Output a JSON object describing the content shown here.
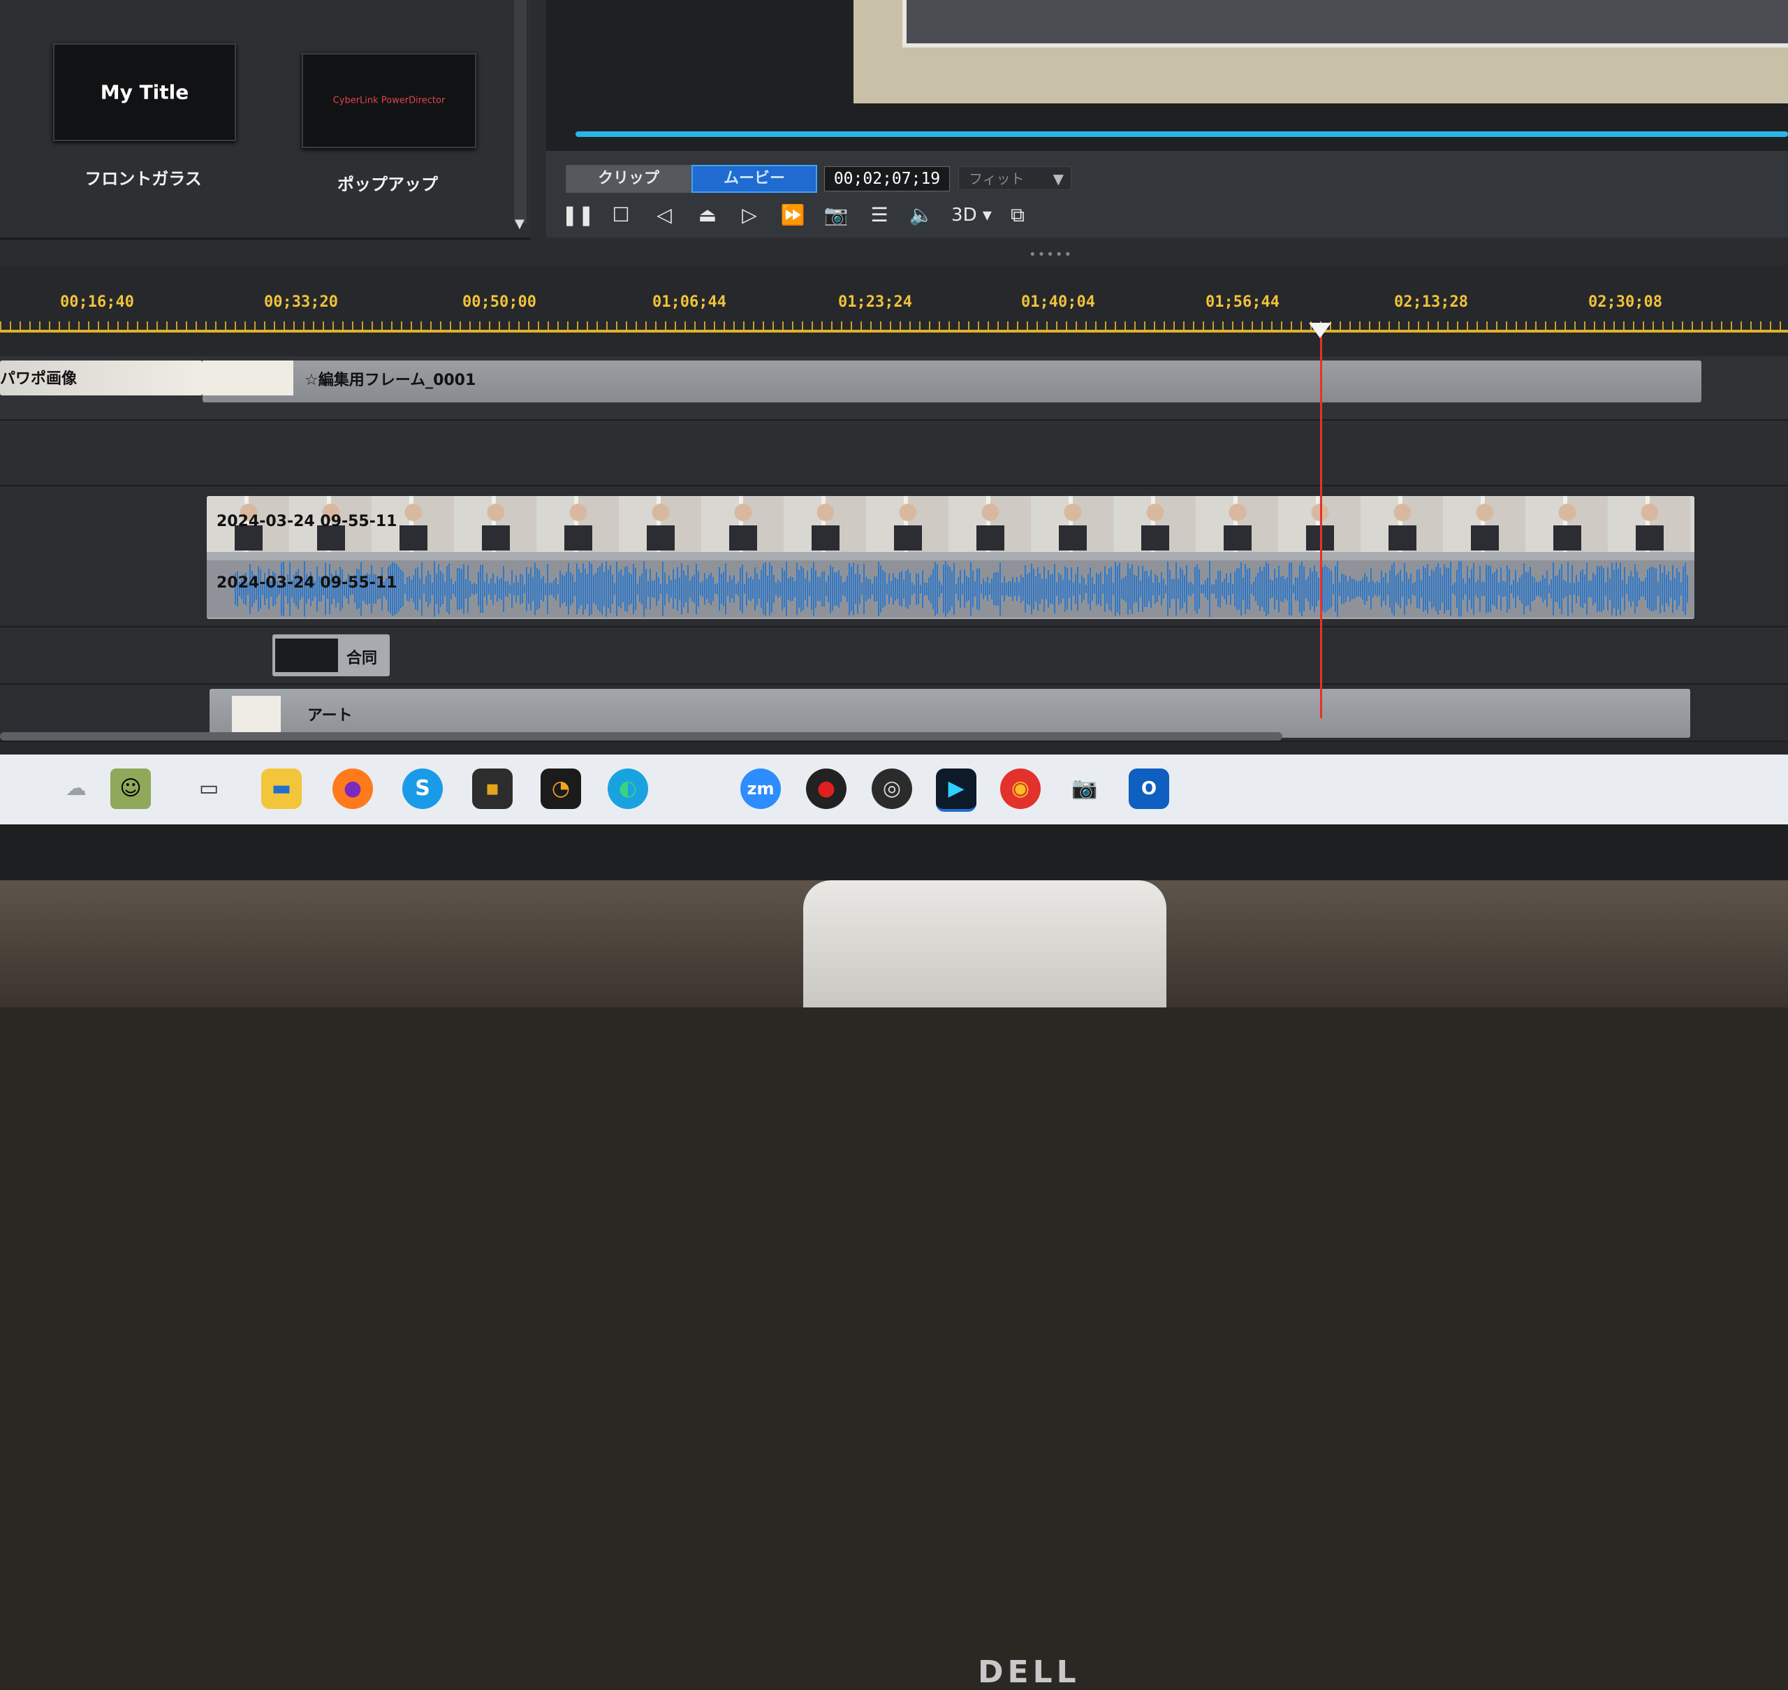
{
  "title_panel": {
    "items": [
      {
        "thumb_text": "My Title",
        "name": "フロントガラス"
      },
      {
        "thumb_text": "CyberLink PowerDirector",
        "name": "ポップアップ"
      }
    ]
  },
  "preview": {
    "mode_tabs": [
      "クリップ",
      "ムービー"
    ],
    "active_mode": "ムービー",
    "timecode": "00;02;07;19",
    "fit_select": "フィット",
    "three_d_label": "3D"
  },
  "timeline": {
    "ruler_labels": [
      "00;16;40",
      "00;33;20",
      "00;50;00",
      "01;06;44",
      "01;23;24",
      "01;40;04",
      "01;56;44",
      "02;13;28",
      "02;30;08"
    ],
    "tracks": {
      "image_track_left_label": "パワポ画像",
      "image_track_clip_label": "☆編集用フレーム_0001",
      "video_clip_label": "2024-03-24 09-55-11",
      "audio_clip_label": "2024-03-24 09-55-11",
      "title_clip_label": "合同",
      "art_clip_label": "アート"
    },
    "playhead_progress": 0.82
  },
  "taskbar": {
    "icons": [
      "weather-icon",
      "avatar-icon",
      "task-view-icon",
      "file-explorer-icon",
      "firefox-icon",
      "skype-icon",
      "app-icon",
      "app-clock-icon",
      "edge-icon",
      "zoom-icon",
      "record-icon",
      "obs-icon",
      "powerdirector-icon",
      "chrome-icon",
      "camera-icon",
      "outlook-icon"
    ],
    "zoom_label": "zm",
    "skype_label": "S"
  },
  "monitor": {
    "brand": "DELL"
  },
  "colors": {
    "accent": "#29b6e8",
    "ruler": "#f1c33a",
    "playhead": "#e8312a",
    "waveform": "#2f78c9"
  }
}
